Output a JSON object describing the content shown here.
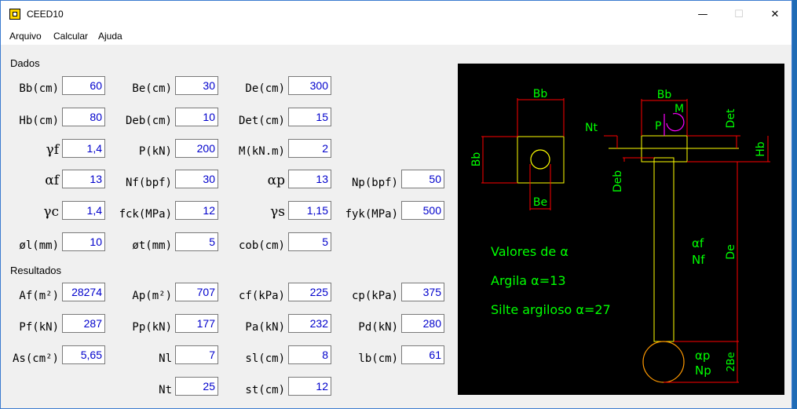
{
  "window": {
    "title": "CEED10",
    "minimize": "—",
    "maximize": "☐",
    "close": "✕"
  },
  "menu": [
    "Arquivo",
    "Calcular",
    "Ajuda"
  ],
  "sections": {
    "dados": "Dados",
    "resultados": "Resultados"
  },
  "dados": [
    {
      "label": "Bb(cm)",
      "value": "60"
    },
    {
      "label": "Be(cm)",
      "value": "30"
    },
    {
      "label": "De(cm)",
      "value": "300"
    },
    {
      "label": "Hb(cm)",
      "value": "80"
    },
    {
      "label": "Deb(cm)",
      "value": "10"
    },
    {
      "label": "Det(cm)",
      "value": "15"
    },
    {
      "label": "γf",
      "value": "1,4"
    },
    {
      "label": "P(kN)",
      "value": "200"
    },
    {
      "label": "M(kN.m)",
      "value": "2"
    },
    {
      "label": "αf",
      "value": "13"
    },
    {
      "label": "Nf(bpf)",
      "value": "30"
    },
    {
      "label": "αp",
      "value": "13"
    },
    {
      "label": "Np(bpf)",
      "value": "50"
    },
    {
      "label": "γc",
      "value": "1,4"
    },
    {
      "label": "fck(MPa)",
      "value": "12"
    },
    {
      "label": "γs",
      "value": "1,15"
    },
    {
      "label": "fyk(MPa)",
      "value": "500"
    },
    {
      "label": "øl(mm)",
      "value": "10"
    },
    {
      "label": "øt(mm)",
      "value": "5"
    },
    {
      "label": "cob(cm)",
      "value": "5"
    }
  ],
  "resultados": [
    {
      "label": "Af(m²)",
      "value": "28274"
    },
    {
      "label": "Ap(m²)",
      "value": "707"
    },
    {
      "label": "cf(kPa)",
      "value": "225"
    },
    {
      "label": "cp(kPa)",
      "value": "375"
    },
    {
      "label": "Pf(kN)",
      "value": "287"
    },
    {
      "label": "Pp(kN)",
      "value": "177"
    },
    {
      "label": "Pa(kN)",
      "value": "232"
    },
    {
      "label": "Pd(kN)",
      "value": "280"
    },
    {
      "label": "As(cm²)",
      "value": "5,65"
    },
    {
      "label": "Nl",
      "value": "7"
    },
    {
      "label": "sl(cm)",
      "value": "8"
    },
    {
      "label": "lb(cm)",
      "value": "61"
    },
    {
      "label": "Nt",
      "value": "25"
    },
    {
      "label": "st(cm)",
      "value": "12"
    }
  ],
  "drawing": {
    "colors": {
      "dimension": "#ff0000",
      "outline": "#ffff00",
      "text": "#00ff00",
      "ring": "#ff9900",
      "moment": "#ff00ff"
    },
    "labels": {
      "bb_left": "Bb",
      "be_left": "Be",
      "bb_side": "Bb",
      "bb_right": "Bb",
      "m": "M",
      "p": "P",
      "nt": "Nt",
      "det": "Det",
      "hb": "Hb",
      "deb": "Deb",
      "af": "αf",
      "nf": "Nf",
      "de": "De",
      "ap": "αp",
      "np": "Np",
      "twobe": "2Be"
    },
    "legend": {
      "title": "Valores de α",
      "argila": "Argila α=13",
      "silte": "Silte argiloso α=27"
    }
  }
}
